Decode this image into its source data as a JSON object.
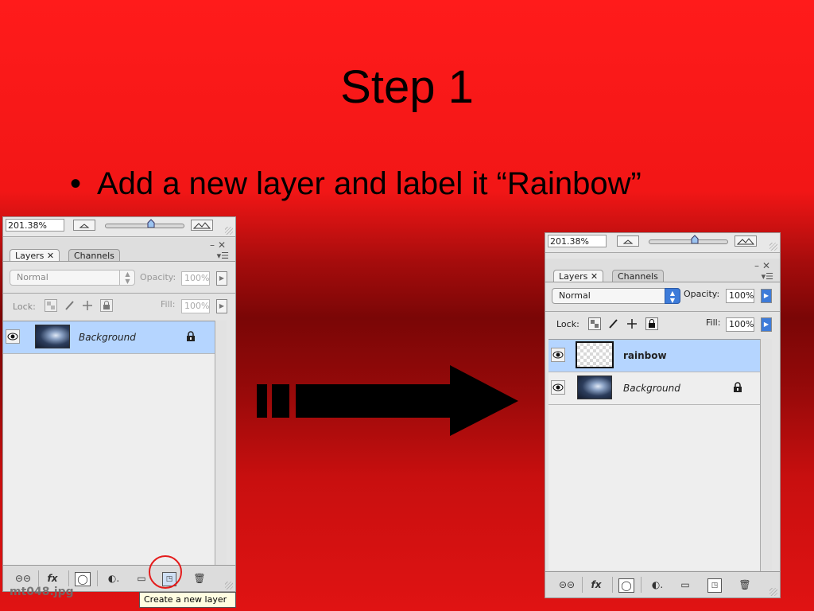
{
  "slide": {
    "title": "Step 1",
    "bullet": "Add a new layer and label it “Rainbow”"
  },
  "colors": {
    "background_top": "#ff1b1b",
    "background_middle": "#7a0606",
    "selection": "#b5d5ff",
    "tooltip_bg": "#fffde1",
    "highlight_circle": "#e41b1b"
  },
  "left_panel": {
    "zoom_value": "201.38%",
    "tabs": {
      "layers": "Layers ✕",
      "channels": "Channels"
    },
    "blend_mode": "Normal",
    "opacity_label": "Opacity:",
    "opacity_value": "100%",
    "lock_label": "Lock:",
    "fill_label": "Fill:",
    "fill_value": "100%",
    "layers": [
      {
        "name": "Background",
        "selected": true,
        "locked": true
      }
    ],
    "footer_buttons": [
      "link-icon",
      "fx",
      "mask-icon",
      "adjustment-icon",
      "folder-icon",
      "new-layer-icon",
      "trash-icon"
    ],
    "fx_label": "fx",
    "tooltip": "Create a new layer",
    "filename": "mt048.jpg"
  },
  "right_panel": {
    "zoom_value": "201.38%",
    "tabs": {
      "layers": "Layers ✕",
      "channels": "Channels"
    },
    "blend_mode": "Normal",
    "opacity_label": "Opacity:",
    "opacity_value": "100%",
    "lock_label": "Lock:",
    "fill_label": "Fill:",
    "fill_value": "100%",
    "layers": [
      {
        "name": "rainbow",
        "selected": true,
        "locked": false
      },
      {
        "name": "Background",
        "selected": false,
        "locked": true
      }
    ],
    "fx_label": "fx"
  }
}
